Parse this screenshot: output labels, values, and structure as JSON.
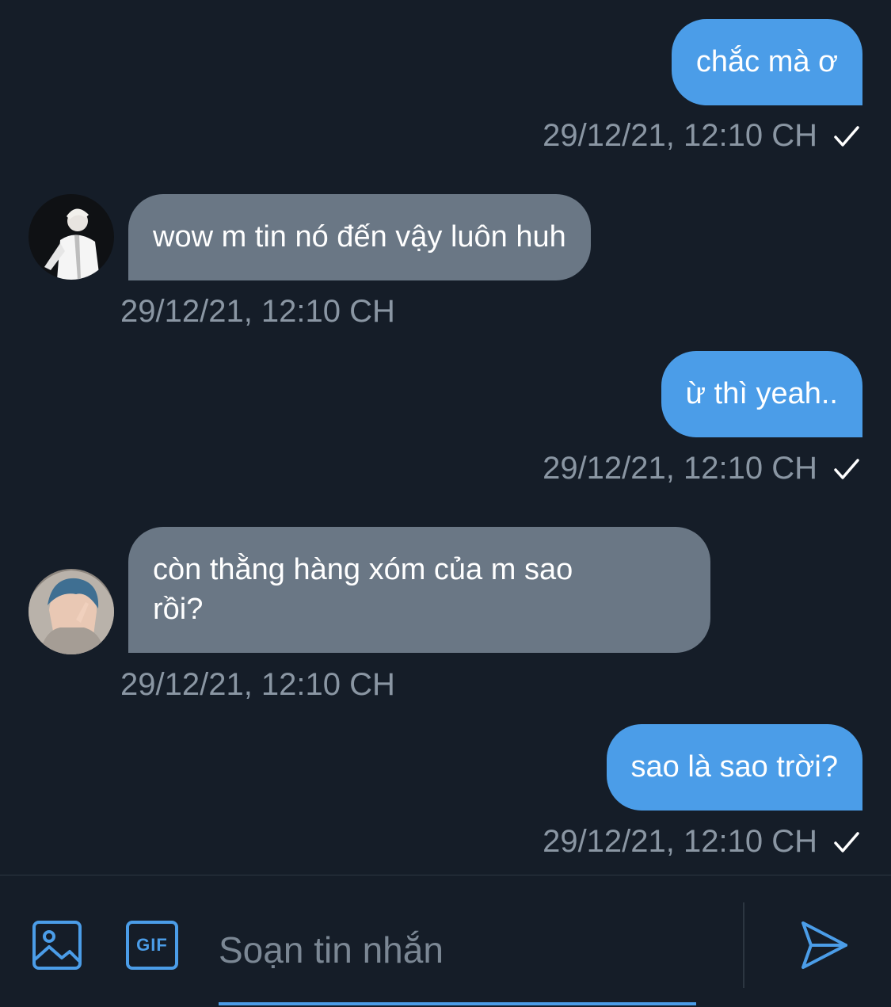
{
  "messages": [
    {
      "direction": "outgoing",
      "text": "chắc mà ơ",
      "timestamp": "29/12/21, 12:10 CH",
      "status": "sent-check-icon"
    },
    {
      "direction": "incoming",
      "text": "wow m tin nó đến vậy luôn huh",
      "timestamp": "29/12/21, 12:10 CH",
      "avatar": "contact-avatar-1"
    },
    {
      "direction": "outgoing",
      "text": "ừ thì yeah..",
      "timestamp": "29/12/21, 12:10 CH",
      "status": "sent-check-icon"
    },
    {
      "direction": "incoming",
      "text": "còn thằng hàng xóm của m sao\nrồi?",
      "timestamp": "29/12/21, 12:10 CH",
      "avatar": "contact-avatar-2"
    },
    {
      "direction": "outgoing",
      "text": "sao là sao trời?",
      "timestamp": "29/12/21, 12:10 CH",
      "status": "sent-check-icon"
    }
  ],
  "composer": {
    "placeholder": "Soạn tin nhắn",
    "value": "",
    "gif_label": "GIF",
    "icons": [
      "image-icon",
      "gif-icon",
      "send-icon"
    ]
  },
  "colors": {
    "background": "#151d28",
    "outgoing_bubble": "#4b9de8",
    "incoming_bubble": "#6a7785",
    "timestamp": "#8a96a3",
    "accent": "#4b9de8"
  }
}
